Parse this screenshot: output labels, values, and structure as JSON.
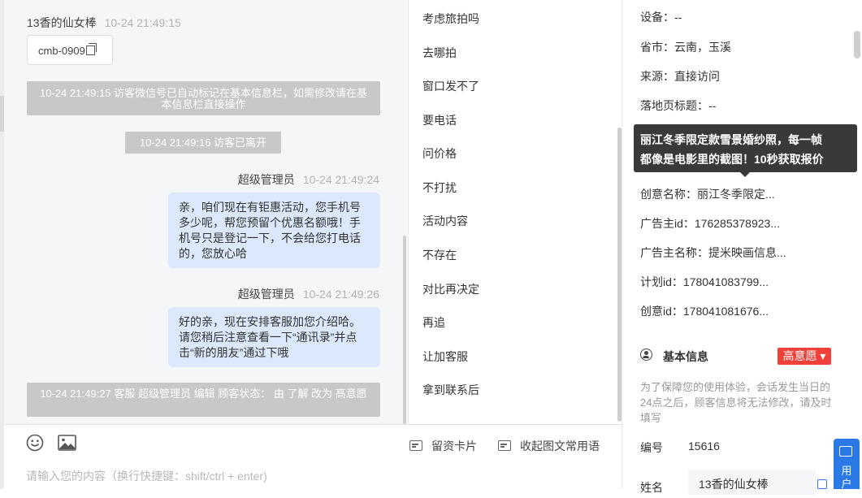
{
  "chat": {
    "visitor_name": "13香的仙女棒",
    "visitor_time": "10-24 21:49:15",
    "visitor_card_text": "cmb-0909",
    "system_messages": [
      "10-24 21:49:15 访客微信号已自动标记在基本信息栏，如需修改请在基本信息栏直接操作",
      "10-24 21:49:16 访客已离开",
      "10-24 21:49:27 客服 超级管理员 编辑 顾客状态： 由 了解 改为 高意愿"
    ],
    "agent_messages": [
      {
        "name": "超级管理员",
        "time": "10-24 21:49:24",
        "text": "亲，咱们现在有钜惠活动，您手机号多少呢，帮您预留个优惠名额哦！手机号只是登记一下，不会给您打电话的，您放心哈"
      },
      {
        "name": "超级管理员",
        "time": "10-24 21:49:26",
        "text": "好的亲，现在安排客服加您介绍哈。请您稍后注意查看一下“通讯录”并点击“新的朋友”通过下哦"
      }
    ]
  },
  "input_bar": {
    "emoji_icon": "smiley-icon",
    "image_icon": "image-icon",
    "card_button_label": "留资卡片",
    "phrase_button_label": "收起图文常用语",
    "placeholder": "请输入您的内容（换行快捷键：shift/ctrl + enter)"
  },
  "quick_replies": [
    "考虑旅拍吗",
    "去哪拍",
    "窗口发不了",
    "要电话",
    "问价格",
    "不打扰",
    "活动内容",
    "不存在",
    "对比再决定",
    "再追",
    "让加客服",
    "拿到联系后"
  ],
  "info_panel": {
    "lines": [
      "设备：--",
      "省市：云南，玉溪",
      "来源：直接访问",
      "落地页标题：--",
      "",
      "",
      "创意名称：丽江冬季限定...",
      "广告主id：176285378923...",
      "广告主名称：提米映画信息...",
      "计划id：178041083799...",
      "创意id：178041081676..."
    ],
    "tooltip_lines": [
      "丽江冬季限定款雪景婚纱照，每一帧",
      "都像是电影里的截图！10秒获取报价"
    ],
    "basic_info_title": "基本信息",
    "intent_badge": "高意愿 ▾",
    "notice": "为了保障您的使用体验，会话发生当日的24点之后，顾客信息将无法修改，请及时填写",
    "id_label": "编号",
    "id_value": "15616",
    "name_label": "姓名",
    "name_value": "13香的仙女棒",
    "badge_color": "#f0403a"
  },
  "float_button": {
    "label": "用户"
  },
  "colors": {
    "agent_bubble": "#dce8fc",
    "system_message": "#c8c8c8",
    "accent": "#2b79e6"
  }
}
